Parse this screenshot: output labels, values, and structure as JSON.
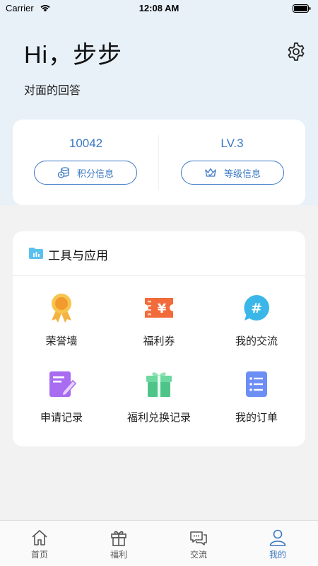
{
  "status_bar": {
    "carrier": "Carrier",
    "time": "12:08 AM"
  },
  "header": {
    "greeting": "Hi，步步",
    "subtitle": "对面的回答",
    "settings_icon": "gear-icon"
  },
  "stats": {
    "points": {
      "value": "10042",
      "button_label": "积分信息",
      "icon": "coins-icon"
    },
    "level": {
      "value": "LV.3",
      "button_label": "等级信息",
      "icon": "crown-icon"
    }
  },
  "tools": {
    "title": "工具与应用",
    "title_icon": "folder-chart-icon",
    "items": [
      {
        "label": "荣誉墙",
        "icon": "medal-icon"
      },
      {
        "label": "福利券",
        "icon": "ticket-icon"
      },
      {
        "label": "我的交流",
        "icon": "hashtag-chat-icon"
      },
      {
        "label": "申请记录",
        "icon": "edit-note-icon"
      },
      {
        "label": "福利兑换记录",
        "icon": "gift-icon"
      },
      {
        "label": "我的订单",
        "icon": "list-icon"
      }
    ]
  },
  "tab_bar": {
    "items": [
      {
        "label": "首页",
        "icon": "home-icon",
        "active": false
      },
      {
        "label": "福利",
        "icon": "gift-icon",
        "active": false
      },
      {
        "label": "交流",
        "icon": "chat-icon",
        "active": false
      },
      {
        "label": "我的",
        "icon": "person-icon",
        "active": true
      }
    ]
  },
  "colors": {
    "accent": "#3a78c2",
    "hero_background": "#e8f0f8",
    "page_background": "#f2f2f2"
  }
}
